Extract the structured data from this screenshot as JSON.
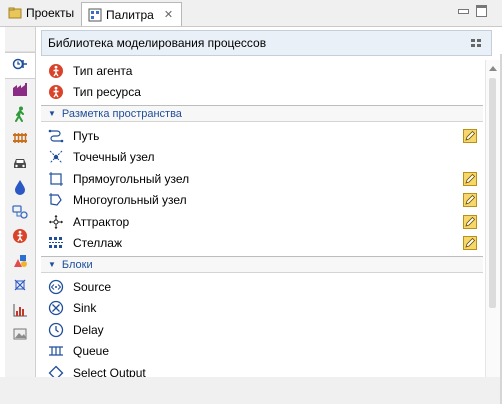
{
  "tabs": {
    "projects_label": "Проекты",
    "palette_label": "Палитра",
    "close_glyph": "✕"
  },
  "library": {
    "title": "Библиотека моделирования процессов"
  },
  "sidebar": {
    "icons": [
      "process-modeling-icon",
      "factory-icon",
      "pedestrian-icon",
      "rail-icon",
      "car-icon",
      "fluid-icon",
      "agent-based-icon",
      "agent-icon",
      "presentation-icon",
      "space-markup-icon",
      "analysis-icon",
      "pictures-icon"
    ]
  },
  "items": {
    "agent_type": "Тип агента",
    "resource_type": "Тип ресурса",
    "space_section": "Разметка пространства",
    "path": "Путь",
    "point_node": "Точечный узел",
    "rect_node": "Прямоугольный узел",
    "poly_node": "Многоугольный узел",
    "attractor": "Аттрактор",
    "rack": "Стеллаж",
    "blocks_section": "Блоки",
    "source": "Source",
    "sink": "Sink",
    "delay": "Delay",
    "queue": "Queue",
    "select_output": "Select Output"
  },
  "colors": {
    "accent": "#1f4e9b",
    "agent_red": "#d8432a",
    "pencil": "#e9b418"
  }
}
